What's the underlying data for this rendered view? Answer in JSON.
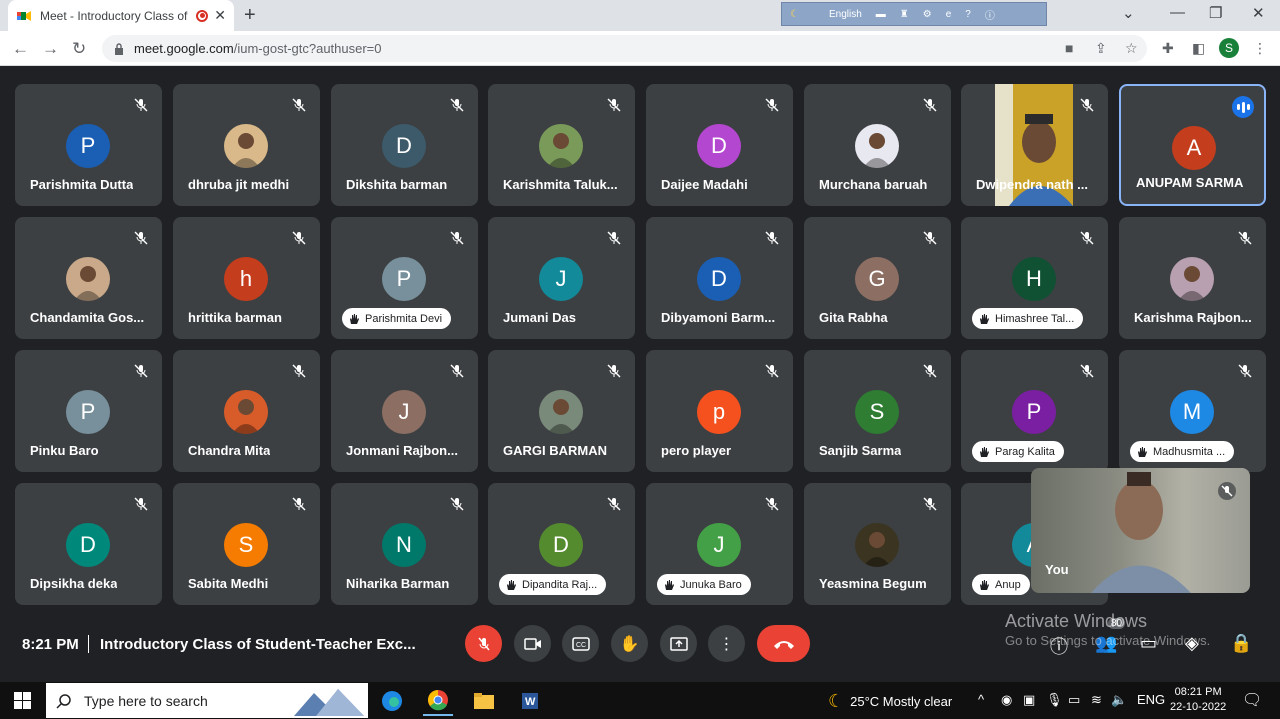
{
  "browser": {
    "tab_title": "Meet - Introductory Class of",
    "url_host": "meet.google.com",
    "url_path": "/ium-gost-gtc?authuser=0",
    "ime_language": "English",
    "profile_initial": "S"
  },
  "participants": [
    {
      "name": "Parishmita Dutta",
      "initial": "P",
      "color": "#1a5fb4",
      "style": "name"
    },
    {
      "name": "dhruba jit medhi",
      "initial": "",
      "color": "#d9b98a",
      "style": "name",
      "photo": true
    },
    {
      "name": "Dikshita barman",
      "initial": "D",
      "color": "#3d5a6b",
      "style": "name"
    },
    {
      "name": "Karishmita Taluk...",
      "initial": "",
      "color": "#7a9a5a",
      "style": "name",
      "photo": true
    },
    {
      "name": "Daijee Madahi",
      "initial": "D",
      "color": "#b447d0",
      "style": "name"
    },
    {
      "name": "Murchana baruah",
      "initial": "",
      "color": "#e8e8f0",
      "style": "name",
      "photo": true
    },
    {
      "name": "Dwipendra nath ...",
      "initial": "",
      "color": "#c9a227",
      "style": "video"
    },
    {
      "name": "ANUPAM SARMA",
      "initial": "A",
      "color": "#c43d1d",
      "style": "active"
    },
    {
      "name": "Chandamita Gos...",
      "initial": "",
      "color": "#c9a98a",
      "style": "name",
      "photo": true
    },
    {
      "name": "hrittika barman",
      "initial": "h",
      "color": "#c43d1d",
      "style": "name"
    },
    {
      "name": "Parishmita Devi",
      "initial": "P",
      "color": "#78909c",
      "style": "pill"
    },
    {
      "name": "Jumani Das",
      "initial": "J",
      "color": "#138a9a",
      "style": "name"
    },
    {
      "name": "Dibyamoni Barm...",
      "initial": "D",
      "color": "#1a5fb4",
      "style": "name"
    },
    {
      "name": "Gita Rabha",
      "initial": "G",
      "color": "#8d6e63",
      "style": "name"
    },
    {
      "name": "Himashree Tal...",
      "initial": "H",
      "color": "#0f5132",
      "style": "pill"
    },
    {
      "name": "Karishma Rajbon...",
      "initial": "",
      "color": "#b8a0b0",
      "style": "name",
      "photo": true
    },
    {
      "name": "Pinku Baro",
      "initial": "P",
      "color": "#78909c",
      "style": "name"
    },
    {
      "name": "Chandra Mita",
      "initial": "",
      "color": "#d85c2a",
      "style": "name",
      "photo": true
    },
    {
      "name": "Jonmani Rajbon...",
      "initial": "J",
      "color": "#8d6e63",
      "style": "name"
    },
    {
      "name": "GARGI BARMAN",
      "initial": "",
      "color": "#7a8a7a",
      "style": "name",
      "photo": true
    },
    {
      "name": "pero player",
      "initial": "p",
      "color": "#f4511e",
      "style": "name"
    },
    {
      "name": "Sanjib Sarma",
      "initial": "S",
      "color": "#2e7d32",
      "style": "name"
    },
    {
      "name": "Parag Kalita",
      "initial": "P",
      "color": "#7b1fa2",
      "style": "pill"
    },
    {
      "name": "Madhusmita ...",
      "initial": "M",
      "color": "#1e88e5",
      "style": "pill"
    },
    {
      "name": "Dipsikha deka",
      "initial": "D",
      "color": "#00897b",
      "style": "name"
    },
    {
      "name": "Sabita Medhi",
      "initial": "S",
      "color": "#f57c00",
      "style": "name"
    },
    {
      "name": "Niharika Barman",
      "initial": "N",
      "color": "#00796b",
      "style": "name"
    },
    {
      "name": "Dipandita Raj...",
      "initial": "D",
      "color": "#558b2f",
      "style": "pill"
    },
    {
      "name": "Junuka Baro",
      "initial": "J",
      "color": "#43a047",
      "style": "pill"
    },
    {
      "name": "Yeasmina Begum",
      "initial": "",
      "color": "#3a3420",
      "style": "name",
      "photo": true
    },
    {
      "name": "Anup",
      "initial": "A",
      "color": "#138a9a",
      "style": "pill"
    }
  ],
  "self_view": {
    "label": "You"
  },
  "meeting": {
    "time": "8:21 PM",
    "title": "Introductory Class of Student-Teacher Exc...",
    "people_count": "80"
  },
  "watermark": {
    "line1": "Activate Windows",
    "line2": "Go to Settings to activate Windows."
  },
  "taskbar": {
    "search_placeholder": "Type here to search",
    "weather": "25°C  Mostly clear",
    "lang": "ENG",
    "time": "08:21 PM",
    "date": "22-10-2022"
  }
}
